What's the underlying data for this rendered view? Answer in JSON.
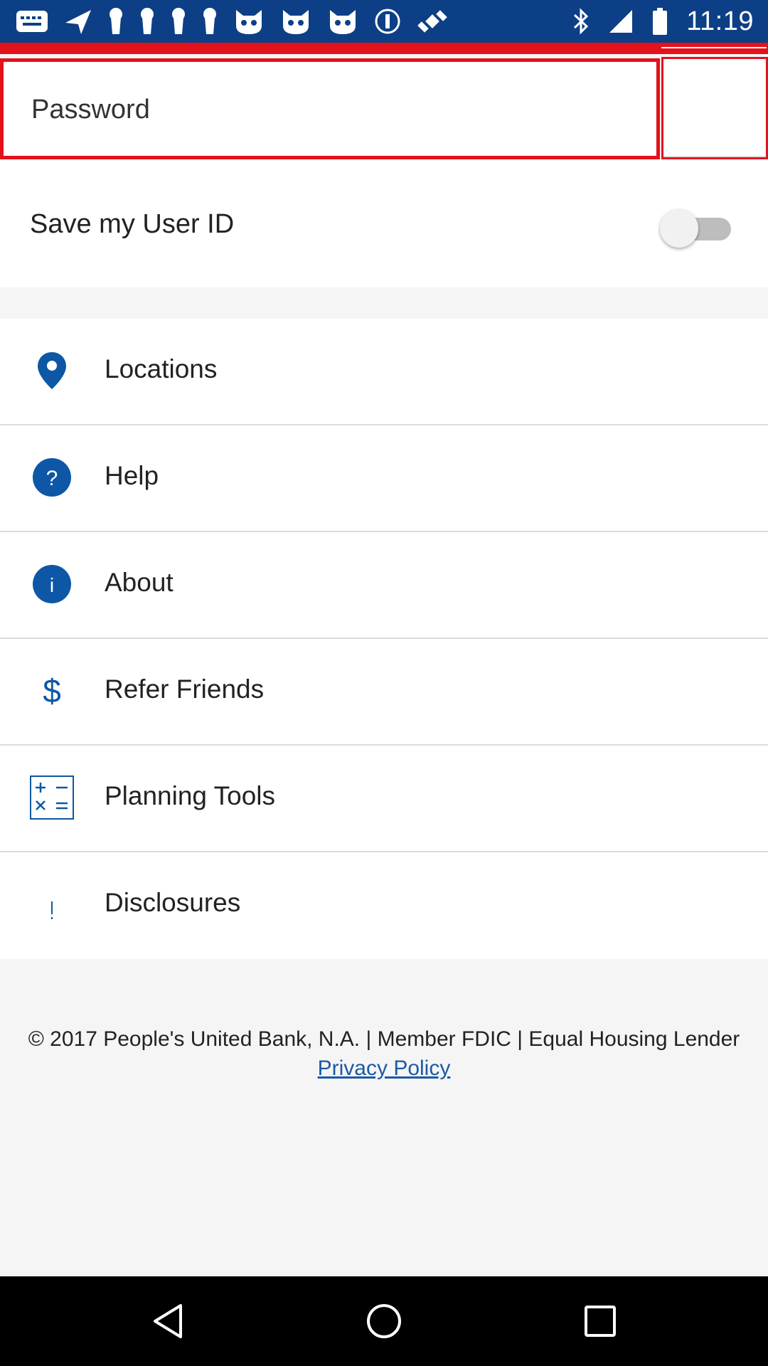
{
  "status_bar": {
    "time": "11:19",
    "icons_left": [
      "messages-icon",
      "navigation-icon",
      "keyhole-icon",
      "keyhole-icon",
      "keyhole-icon",
      "keyhole-icon",
      "cat-icon",
      "cat-icon",
      "cat-icon",
      "info-circle-icon",
      "fake-gps-satellite-icon"
    ],
    "icons_right": [
      "bluetooth-icon",
      "signal-icon",
      "battery-icon"
    ],
    "background": "#0d3f86"
  },
  "login": {
    "password_placeholder": "Password",
    "save_user_id_label": "Save my User ID",
    "save_user_id_enabled": false
  },
  "menu": {
    "items": [
      {
        "label": "Locations",
        "icon": "location-pin-icon"
      },
      {
        "label": "Help",
        "icon": "help-circle-icon"
      },
      {
        "label": "About",
        "icon": "info-circle-icon"
      },
      {
        "label": "Refer Friends",
        "icon": "dollar-icon"
      },
      {
        "label": "Planning Tools",
        "icon": "calculator-icon"
      },
      {
        "label": "Disclosures",
        "icon": "exclamation-icon"
      }
    ]
  },
  "footer": {
    "copyright": "© 2017 People's United Bank, N.A. | Member FDIC | Equal Housing Lender",
    "privacy_link": "Privacy Policy"
  },
  "colors": {
    "accent_red": "#e3121b",
    "icon_blue": "#0d57a6",
    "link_blue": "#1b5aa6"
  },
  "nav_bar": {
    "buttons": [
      "back-icon",
      "home-icon",
      "recents-icon"
    ]
  }
}
